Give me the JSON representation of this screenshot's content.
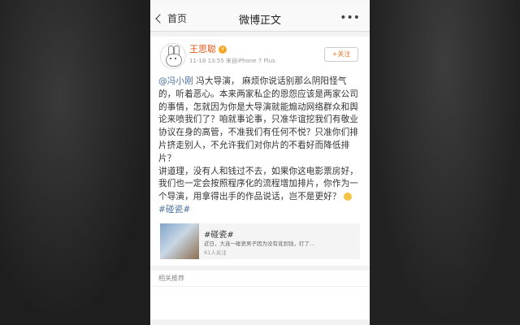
{
  "nav": {
    "back_label": "首页",
    "title": "微博正文",
    "more_icon": "more-dots-icon"
  },
  "post": {
    "author_name": "王思聪",
    "meta": "11-18 13:55  来自iPhone 7 Plus",
    "follow_label": "+关注",
    "mention": "@冯小刚",
    "paragraph1_rest": " 冯大导演， 麻烦你说话别那么阴阳怪气的，听着恶心。本来两家私企的恩怨应该是两家公司的事情，怎就因为你是大导演就能煽动网络群众和舆论来喷我们了？咱就事论事，只准华谊挖我们有敬业协议在身的高管，不准我们有任何不悦？只准你们排片挤走别人，不允许我们对你片的不看好而降低排片？",
    "paragraph2": "讲道理，没有人和钱过不去，如果你这电影票房好，我们也一定会按照程序化的流程增加排片，你作为一个导演，用拿得出手的作品说话，岂不是更好？",
    "hashtag": "#碰瓷#"
  },
  "share_card": {
    "title": "#碰瓷#",
    "desc": "近日，大连一碰瓷男子因为没有讹到钱，打了...",
    "count": "61人关注"
  },
  "related": {
    "title": "相关推荐"
  }
}
